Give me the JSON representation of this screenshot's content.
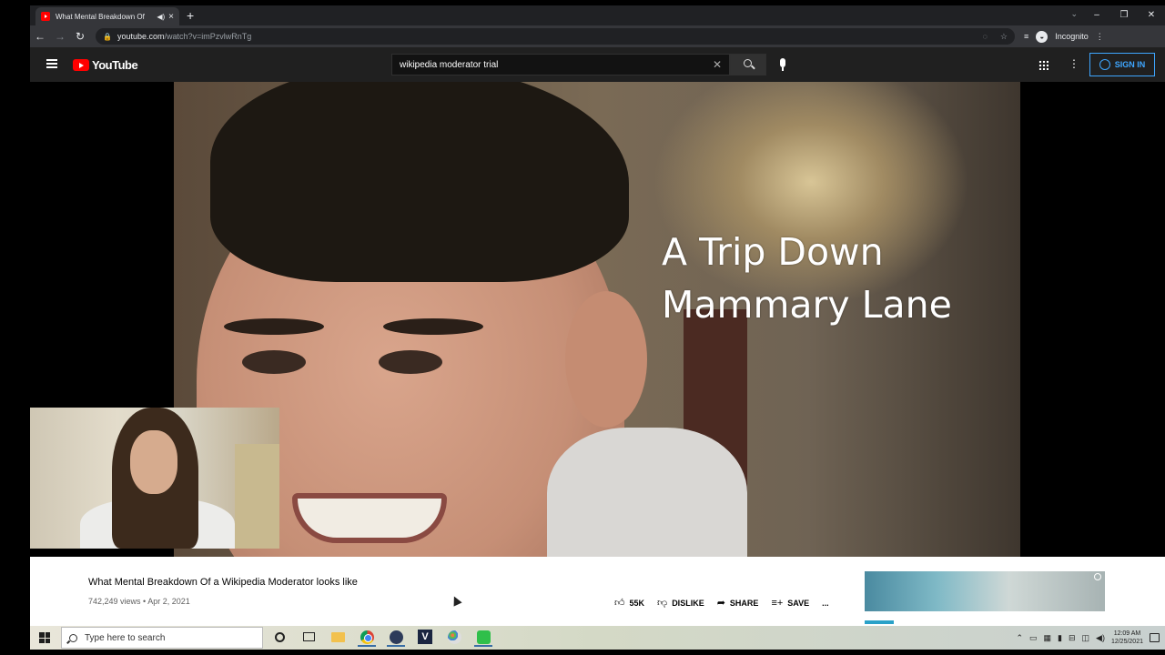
{
  "browser": {
    "tab_title": "What Mental Breakdown Of",
    "tab_audio_icon": "speaker-icon",
    "new_tab_label": "+",
    "url_host": "youtube.com",
    "url_path": "/watch?v=imPzvlwRnTg",
    "profile_label": "Incognito"
  },
  "youtube": {
    "logo_text": "YouTube",
    "search_value": "wikipedia moderator trial",
    "sign_in_label": "SIGN IN"
  },
  "video": {
    "overlay_line1": "A Trip Down",
    "overlay_line2": "Mammary Lane",
    "title": "What Mental Breakdown Of a Wikipedia Moderator looks like",
    "views_date": "742,249 views • Apr 2, 2021",
    "actions": {
      "like_count": "55K",
      "dislike_label": "DISLIKE",
      "share_label": "SHARE",
      "save_label": "SAVE",
      "more_label": "..."
    }
  },
  "taskbar": {
    "search_placeholder": "Type here to search",
    "time": "12:09 AM",
    "date": "12/25/2021"
  },
  "colors": {
    "yt_red": "#ff0000",
    "sign_in_blue": "#3ea6ff",
    "chrome_dark": "#202124"
  }
}
